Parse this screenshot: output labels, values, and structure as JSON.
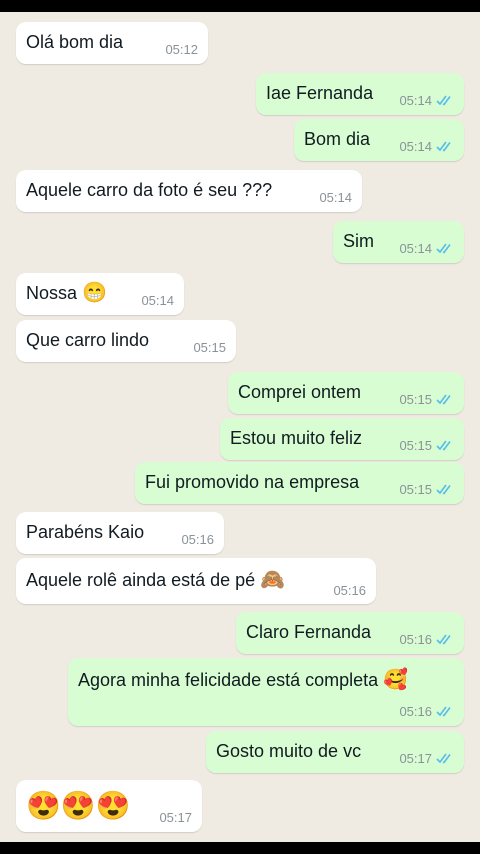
{
  "chat": {
    "messages": [
      {
        "text": "Olá bom dia",
        "time": "05:12",
        "dir": "in"
      },
      {
        "text": "Iae Fernanda",
        "time": "05:14",
        "dir": "out",
        "status": "read"
      },
      {
        "text": "Bom dia",
        "time": "05:14",
        "dir": "out",
        "status": "read"
      },
      {
        "text": "Aquele carro da foto é seu ???",
        "time": "05:14",
        "dir": "in"
      },
      {
        "text": "Sim",
        "time": "05:14",
        "dir": "out",
        "status": "read"
      },
      {
        "text": "Nossa",
        "emoji": "😁",
        "time": "05:14",
        "dir": "in"
      },
      {
        "text": "Que carro lindo",
        "time": "05:15",
        "dir": "in"
      },
      {
        "text": "Comprei ontem",
        "time": "05:15",
        "dir": "out",
        "status": "read"
      },
      {
        "text": "Estou muito feliz",
        "time": "05:15",
        "dir": "out",
        "status": "read"
      },
      {
        "text": "Fui promovido na empresa",
        "time": "05:15",
        "dir": "out",
        "status": "read"
      },
      {
        "text": "Parabéns Kaio",
        "time": "05:16",
        "dir": "in"
      },
      {
        "text": "Aquele rolê ainda está de pé",
        "emoji": "🙈",
        "time": "05:16",
        "dir": "in"
      },
      {
        "text": "Claro Fernanda",
        "time": "05:16",
        "dir": "out",
        "status": "read"
      },
      {
        "text": "Agora minha felicidade está completa",
        "emoji": "🥰",
        "time": "05:16",
        "dir": "out",
        "status": "read"
      },
      {
        "text": "Gosto muito de vc",
        "time": "05:17",
        "dir": "out",
        "status": "read"
      },
      {
        "emoji": "😍😍😍",
        "time": "05:17",
        "dir": "in"
      }
    ]
  },
  "colors": {
    "background": "#efeae2",
    "incoming_bubble": "#ffffff",
    "outgoing_bubble": "#d9fdd3",
    "read_check": "#53bdeb"
  },
  "icons": {
    "read_receipt": "double-check-icon"
  }
}
